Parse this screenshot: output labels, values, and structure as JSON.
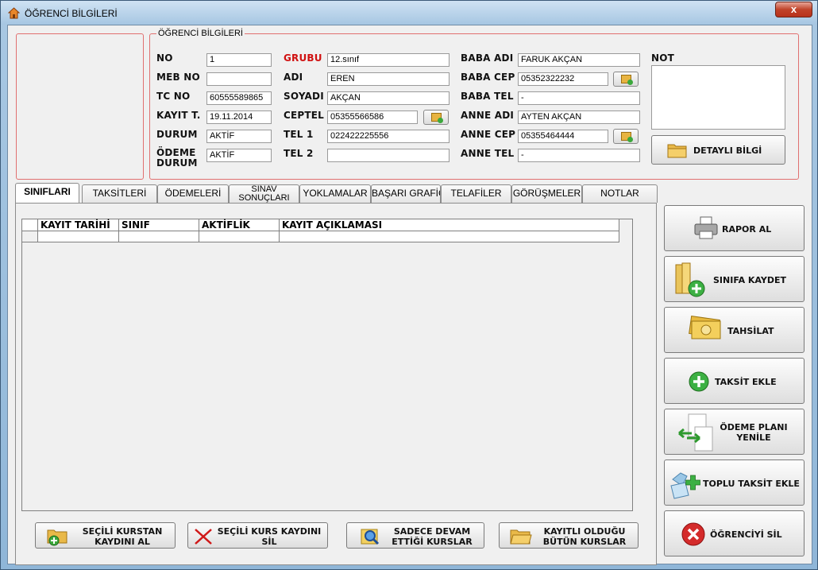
{
  "window": {
    "title": "ÖĞRENCİ BİLGİLERİ",
    "close": "x"
  },
  "group": {
    "title": "ÖĞRENCİ BİLGİLERİ"
  },
  "labels": {
    "no": "NO",
    "meb_no": "MEB NO",
    "tc_no": "TC NO",
    "kayit_t": "KAYIT T.",
    "durum": "DURUM",
    "odeme_durum": "ÖDEME\nDURUM",
    "grubu": "GRUBU",
    "adi": "ADI",
    "soyadi": "SOYADI",
    "ceptel": "CEPTEL",
    "tel1": "TEL 1",
    "tel2": "TEL 2",
    "baba_adi": "BABA ADI",
    "baba_cep": "BABA CEP",
    "baba_tel": "BABA TEL",
    "anne_adi": "ANNE ADI",
    "anne_cep": "ANNE CEP",
    "anne_tel": "ANNE TEL",
    "not": "NOT"
  },
  "fields": {
    "no": "1",
    "meb_no": "",
    "tc_no": "60555589865",
    "kayit_t": "19.11.2014",
    "durum": "AKTİF",
    "odeme_durum": "AKTİF",
    "grubu": "12.sınıf",
    "adi": "EREN",
    "soyadi": "AKÇAN",
    "ceptel": "05355566586",
    "tel1": "022422225556",
    "tel2": "",
    "baba_adi": "FARUK  AKÇAN",
    "baba_cep": "05352322232",
    "baba_tel": "-",
    "anne_adi": "AYTEN AKÇAN",
    "anne_cep": "05355464444",
    "anne_tel": "-"
  },
  "buttons": {
    "detayli": "DETAYLI BİLGİ",
    "rapor": "RAPOR AL",
    "sinifa_kaydet": "SINIFA KAYDET",
    "tahsilat": "TAHSİLAT",
    "taksit_ekle": "TAKSİT EKLE",
    "odeme_plani_1": "ÖDEME PLANI",
    "odeme_plani_2": "YENİLE",
    "toplu_taksit": "TOPLU TAKSİT EKLE",
    "ogrenciyi_sil": "ÖĞRENCİYİ SİL",
    "secili_kurstan_1": "SEÇİLİ KURSTAN",
    "secili_kurstan_2": "KAYDINI AL",
    "secili_kurs_sil_1": "SEÇİLİ KURS KAYDINI",
    "secili_kurs_sil_2": "SİL",
    "sadece_devam_1": "SADECE DEVAM",
    "sadece_devam_2": "ETTİĞİ KURSLAR",
    "kayitli_1": "KAYITLI OLDUĞU",
    "kayitli_2": "BÜTÜN KURSLAR"
  },
  "tabs": [
    "SINIFLARI",
    "TAKSİTLERİ",
    "ÖDEMELERİ",
    "SINAV SONUÇLARI",
    "YOKLAMALAR",
    "BAŞARI GRAFİĞİ",
    "TELAFİLER",
    "GÖRÜŞMELER",
    "NOTLAR"
  ],
  "grid": {
    "columns": [
      "KAYIT TARİHİ",
      "SINIF",
      "AKTİFLİK",
      "KAYIT AÇIKLAMASI"
    ]
  }
}
